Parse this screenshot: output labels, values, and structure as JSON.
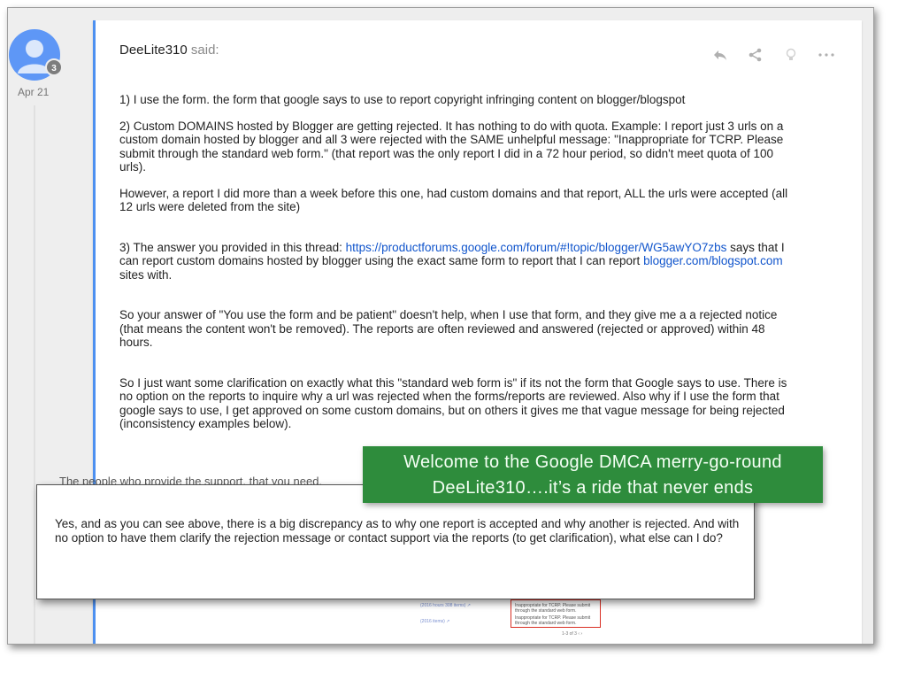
{
  "post": {
    "badge_count": "3",
    "date": "Apr 21",
    "author": "DeeLite310",
    "said": " said:",
    "icons": [
      "reply-icon",
      "share-icon",
      "idea-bulb-icon",
      "more-options-icon"
    ],
    "paragraphs": {
      "p1": "1) I use the form. the form that google says to use to report copyright infringing content on blogger/blogspot",
      "p2": "2) Custom DOMAINS hosted by Blogger are getting rejected.  It has nothing to do with quota. Example: I report just 3 urls on a custom domain hosted by blogger and all 3 were rejected with the SAME unhelpful message: \"Inappropriate for TCRP. Please submit through the standard web form.\" (that report was the only report I did in a 72 hour period, so didn't meet quota of 100 urls).",
      "p3": "However, a report I did more than a week before this one, had custom domains and that report, ALL the urls were accepted (all 12 urls were deleted from the site)",
      "p4_pre": "3)  The answer you provided in this thread: ",
      "p4_link": "https://productforums.google.com/forum/#!topic/blogger/WG5awYO7zbs",
      "p4_mid": " says that I can report custom domains hosted by blogger using the exact same form to report  that I can report ",
      "p4_link2": "blogger.com/blogspot.com",
      "p4_post": " sites with.",
      "p5": "So your answer of \"You use the form and be patient\" doesn't help, when I use that form, and they give me a a rejected notice (that means the content won't be removed).  The reports are often reviewed and answered (rejected or approved) within 48 hours.",
      "p6": "So I just want some clarification on exactly what this \"standard web form is\" if its not the form that Google says to use. There is no option on the reports to inquire why a url was rejected when the forms/reports are reviewed. Also why if I use the form that google says to use, I get approved on some custom domains, but on others it gives me that vague message for being rejected (inconsistency examples below)."
    },
    "behind_text": "The people who provide the support, that you need,"
  },
  "banner": {
    "line1": "Welcome to the Google DMCA merry-go-round",
    "line2": "DeeLite310….it’s a ride that never ends",
    "color": "#2e8c3c"
  },
  "reply": {
    "text": "Yes, and as you can see above, there is a big discrepancy as to why one report is accepted and why another is rejected. And with no option to have them clarify the rejection message or contact support via the reports (to get clarification), what else can I do?"
  },
  "mini_table": {
    "link1": "(2016 hours 308 items) ↗",
    "link2": "(2016 items) ↗",
    "msg1": "Inappropriate for TCRP. Please submit through the standard web form.",
    "msg2": "Inappropriate for TCRP. Please submit through the standard web form.",
    "pagination": "1-3 of 3  ‹  ›"
  },
  "colors": {
    "accent": "#4d90f0",
    "link": "#1155cc",
    "avatar": "#5e97f6"
  }
}
